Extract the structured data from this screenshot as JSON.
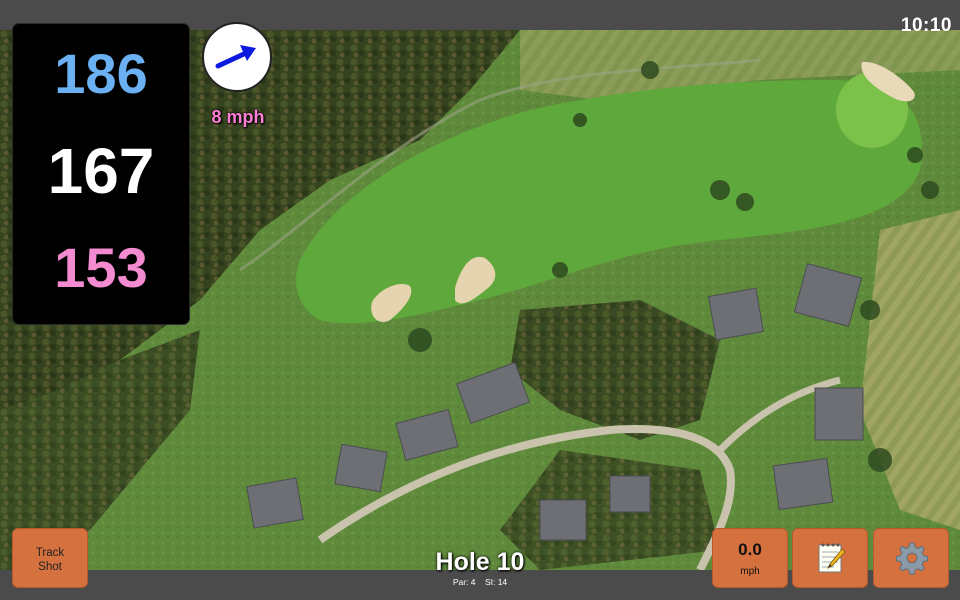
{
  "status_bar": {
    "time": "10:10"
  },
  "distances": {
    "back": "186",
    "middle": "167",
    "front": "153"
  },
  "wind": {
    "speed": "8 mph",
    "icon": "wind-direction-arrow-icon",
    "arrow_color": "#0a1adf"
  },
  "buttons": {
    "track_shot": {
      "line1": "Track",
      "line2": "Shot"
    },
    "speed": {
      "value": "0.0",
      "unit": "mph"
    },
    "notes": {
      "icon": "notepad-icon"
    },
    "settings": {
      "icon": "gear-icon"
    }
  },
  "hole": {
    "title": "Hole 10",
    "par": "Par: 4",
    "si": "SI: 14"
  },
  "colors": {
    "back_distance": "#6bb0f2",
    "middle_distance": "#ffffff",
    "front_distance": "#f48ad0",
    "wind_speed": "#ff7ed6",
    "button": "#d5703f"
  }
}
